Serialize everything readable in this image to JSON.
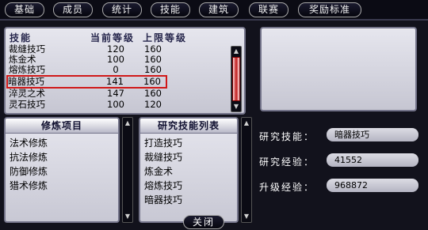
{
  "tabs": [
    {
      "label": "基础"
    },
    {
      "label": "成员"
    },
    {
      "label": "统计"
    },
    {
      "label": "技能"
    },
    {
      "label": "建筑"
    },
    {
      "label": "联赛"
    },
    {
      "label": "奖励标准"
    }
  ],
  "skill_table": {
    "headers": {
      "name": "技能",
      "current": "当前等级",
      "max": "上限等级"
    },
    "rows": [
      {
        "name": "裁缝技巧",
        "current": "120",
        "max": "160"
      },
      {
        "name": "炼金术",
        "current": "100",
        "max": "160"
      },
      {
        "name": "熔炼技巧",
        "current": "0",
        "max": "160"
      },
      {
        "name": "暗器技巧",
        "current": "141",
        "max": "160",
        "selected": true
      },
      {
        "name": "淬灵之术",
        "current": "147",
        "max": "160"
      },
      {
        "name": "灵石技巧",
        "current": "100",
        "max": "120"
      }
    ]
  },
  "training_list": {
    "title": "修炼项目",
    "items": [
      "法术修炼",
      "抗法修炼",
      "防御修炼",
      "猎术修炼"
    ]
  },
  "research_list": {
    "title": "研究技能列表",
    "items": [
      "打造技巧",
      "裁缝技巧",
      "炼金术",
      "熔炼技巧",
      "暗器技巧"
    ]
  },
  "research_info": {
    "skill_label": "研究技能：",
    "skill_value": "暗器技巧",
    "exp_label": "研究经验：",
    "exp_value": "41552",
    "upgrade_label": "升级经验：",
    "upgrade_value": "968872"
  },
  "close_label": "关闭",
  "colors": {
    "selection_outline": "#d01818",
    "scroll_thumb": "#c01818"
  }
}
